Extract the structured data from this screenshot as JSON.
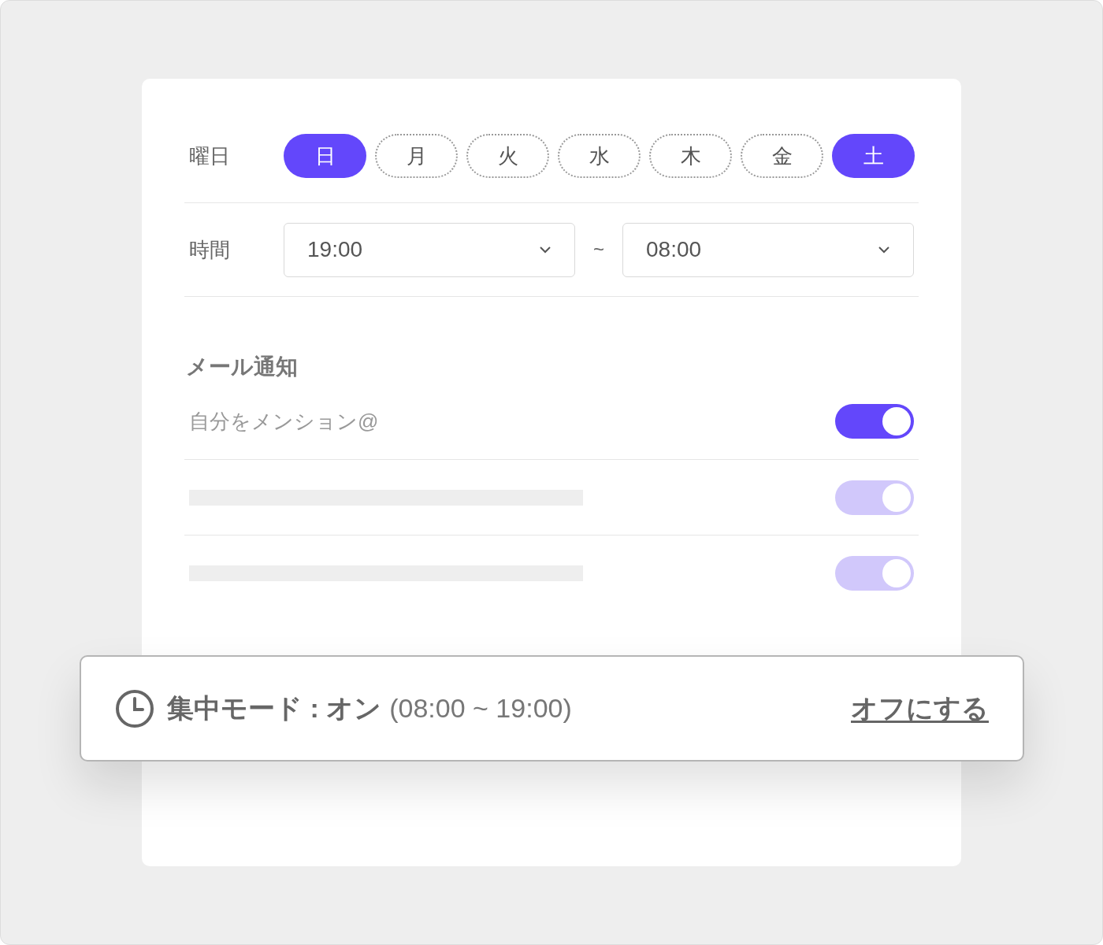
{
  "weekday": {
    "label": "曜日",
    "days": [
      {
        "label": "日",
        "selected": true
      },
      {
        "label": "月",
        "selected": false
      },
      {
        "label": "火",
        "selected": false
      },
      {
        "label": "水",
        "selected": false
      },
      {
        "label": "木",
        "selected": false
      },
      {
        "label": "金",
        "selected": false
      },
      {
        "label": "土",
        "selected": true
      }
    ]
  },
  "time": {
    "label": "時間",
    "start": "19:00",
    "separator": "~",
    "end": "08:00"
  },
  "email_notifications": {
    "heading": "メール通知",
    "items": [
      {
        "kind": "setting",
        "label": "自分をメンション@",
        "on": true,
        "disabled": false
      },
      {
        "kind": "skeleton",
        "on": true,
        "disabled": true
      },
      {
        "kind": "skeleton",
        "on": true,
        "disabled": true
      }
    ]
  },
  "focus_banner": {
    "title": "集中モード : オン",
    "schedule": "(08:00 ~ 19:00)",
    "action": "オフにする"
  }
}
